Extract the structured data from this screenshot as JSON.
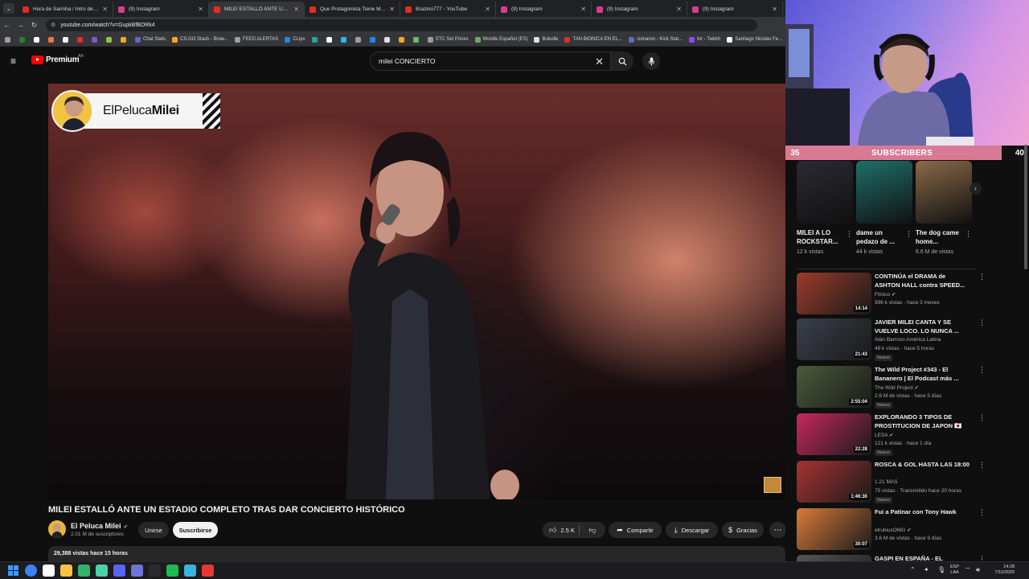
{
  "browser": {
    "tabs": [
      {
        "label": "Hora de Sarinha / Intro de Sar",
        "color": "#e22b2b",
        "active": false
      },
      {
        "label": "(9) Instagram",
        "color": "#d53f8c",
        "active": false
      },
      {
        "label": "MILEI ESTALLÓ ANTE UN E",
        "color": "#e22b2b",
        "active": true
      },
      {
        "label": "Que Protagonista Tiene Mayo",
        "color": "#e22b2b",
        "active": false
      },
      {
        "label": "Brazino777 - YouTube",
        "color": "#e22b2b",
        "active": false
      },
      {
        "label": "(9) Instagram",
        "color": "#d53f8c",
        "active": false
      },
      {
        "label": "(9) Instagram",
        "color": "#d53f8c",
        "active": false
      },
      {
        "label": "(9) Instagram",
        "color": "#d53f8c",
        "active": false
      }
    ],
    "url": "youtube.com/watch?v=GupkBfBDRk4",
    "bookmarks": [
      {
        "label": "",
        "color": "#2e7d32"
      },
      {
        "label": "",
        "color": "#ffffff"
      },
      {
        "label": "",
        "color": "#ff7043"
      },
      {
        "label": "",
        "color": "#ffffff"
      },
      {
        "label": "",
        "color": "#e22b2b"
      },
      {
        "label": "",
        "color": "#7e57c2"
      },
      {
        "label": "",
        "color": "#8bc34a"
      },
      {
        "label": "",
        "color": "#f9a825"
      },
      {
        "label": "Chat Stats",
        "color": "#5c6bc0"
      },
      {
        "label": "CS:GO Stash - Brow...",
        "color": "#f9a825"
      },
      {
        "label": "FEED ALERTAS",
        "color": "#9e9e9e"
      },
      {
        "label": "CLips",
        "color": "#1e88e5"
      },
      {
        "label": "",
        "color": "#26a69a"
      },
      {
        "label": "",
        "color": "#ffffff"
      },
      {
        "label": "",
        "color": "#29b6f6"
      },
      {
        "label": "",
        "color": "#9e9e9e"
      },
      {
        "label": "",
        "color": "#1e88e5"
      },
      {
        "label": "",
        "color": "#e0e0e0"
      },
      {
        "label": "",
        "color": "#f9a825"
      },
      {
        "label": "",
        "color": "#66bb6a"
      },
      {
        "label": "STC Set Prices",
        "color": "#9e9e9e"
      },
      {
        "label": "Wordle Español (ES)",
        "color": "#6aaa64"
      },
      {
        "label": "Boludle",
        "color": "#e0e0e0"
      },
      {
        "label": "TAN BIONICA EN EL...",
        "color": "#e22b2b"
      },
      {
        "label": "cionaron - Kick Stat...",
        "color": "#5c6bc0"
      },
      {
        "label": "tnr - Twitch",
        "color": "#9146ff"
      },
      {
        "label": "Santiago Nicolas Fe...",
        "color": "#ffffff"
      },
      {
        "label": "Ta",
        "color": "#f9a825"
      }
    ]
  },
  "header": {
    "logo": "Premium",
    "country": "AR",
    "search_query": "milei CONCIERTO"
  },
  "video": {
    "banner_prefix": "ElPeluca",
    "banner_bold": "Milei",
    "title": "MILEI ESTALLÓ ANTE UN ESTADIO COMPLETO TRAS DAR CONCIERTO HISTÓRICO",
    "channel": "El Peluca Milei",
    "verified": "✔",
    "subscribers": "2.01 M de suscriptores",
    "join_label": "Unirse",
    "subscribe_label": "Suscribirse",
    "likes": "2.5 K",
    "share_label": "Compartir",
    "download_label": "Descargar",
    "thanks_label": "Gracias",
    "description_meta": "29,388 vistas  hace 15 horas"
  },
  "overlay": {
    "subs_current": "35",
    "subs_label": "SUBSCRIBERS",
    "subs_goal": "40"
  },
  "shorts": [
    {
      "title": "MILEI A LO ROCKSTAR...",
      "views": "12 k vistas",
      "color": "#2a2a33"
    },
    {
      "title": "dame un pedazo de ...",
      "views": "44 k vistas",
      "color": "#1f6f6a"
    },
    {
      "title": "The dog came home...",
      "views": "6.6 M de vistas",
      "color": "#8a6a48"
    }
  ],
  "recommendations": [
    {
      "title": "CONTINÚA el DRAMA de ASHTON HALL contra SPEED...",
      "channel": "Fitnico ✔",
      "meta": "996 k vistas · hace 3 meses",
      "duration": "14:14",
      "badge": "",
      "color": "#9c3b2a"
    },
    {
      "title": "JAVIER MILEI CANTA Y SE VUELVE LOCO. LO NUNCA ...",
      "channel": "Alán Barroso América Latina",
      "meta": "48 k vistas · hace 5 horas",
      "duration": "21:43",
      "badge": "Nuevo",
      "color": "#3a3f4a"
    },
    {
      "title": "The Wild Project #343 - El Bananero | El Podcast más ...",
      "channel": "The Wild Project ✔",
      "meta": "2.6 M de vistas · hace 5 días",
      "duration": "2:55:04",
      "badge": "Nuevo",
      "color": "#4a5a3a"
    },
    {
      "title": "EXPLORANDO 3 TIPOS DE PROSTITUCION DE JAPON 🇯🇵",
      "channel": "LESA ✔",
      "meta": "121 k vistas · hace 1 día",
      "duration": "22:28",
      "badge": "Nuevo",
      "color": "#c7285e"
    },
    {
      "title": "ROSCA & GOL HASTA LAS 18:00",
      "channel": "1.21 MAS",
      "meta": "75 vistas · Transmitido hace 20 horas",
      "duration": "1:46:30",
      "badge": "Nuevo",
      "color": "#a83232"
    },
    {
      "title": "Fui a Patinar con Tony Hawk",
      "channel": "elrubiusOMG ✔",
      "meta": "3.6 M de vistas · hace 9 días",
      "duration": "30:07",
      "badge": "",
      "color": "#d97b3a"
    },
    {
      "title": "GASPI EN ESPAÑA - EL",
      "channel": "",
      "meta": "",
      "duration": "",
      "badge": "",
      "color": "#555555"
    }
  ],
  "taskbar": {
    "apps": [
      {
        "color": "#3b82f6"
      },
      {
        "color": "#ffffff"
      },
      {
        "color": "#f6c343"
      },
      {
        "color": "#30b36b"
      },
      {
        "color": "#4ad1a8"
      },
      {
        "color": "#5865f2"
      },
      {
        "color": "#6d75d8"
      },
      {
        "color": "#2a2a2a"
      },
      {
        "color": "#1db954"
      },
      {
        "color": "#3bb3e0"
      },
      {
        "color": "#e53935"
      }
    ],
    "lang": "ESP\nLAA",
    "time": "14:28",
    "date": "7/10/2025"
  }
}
